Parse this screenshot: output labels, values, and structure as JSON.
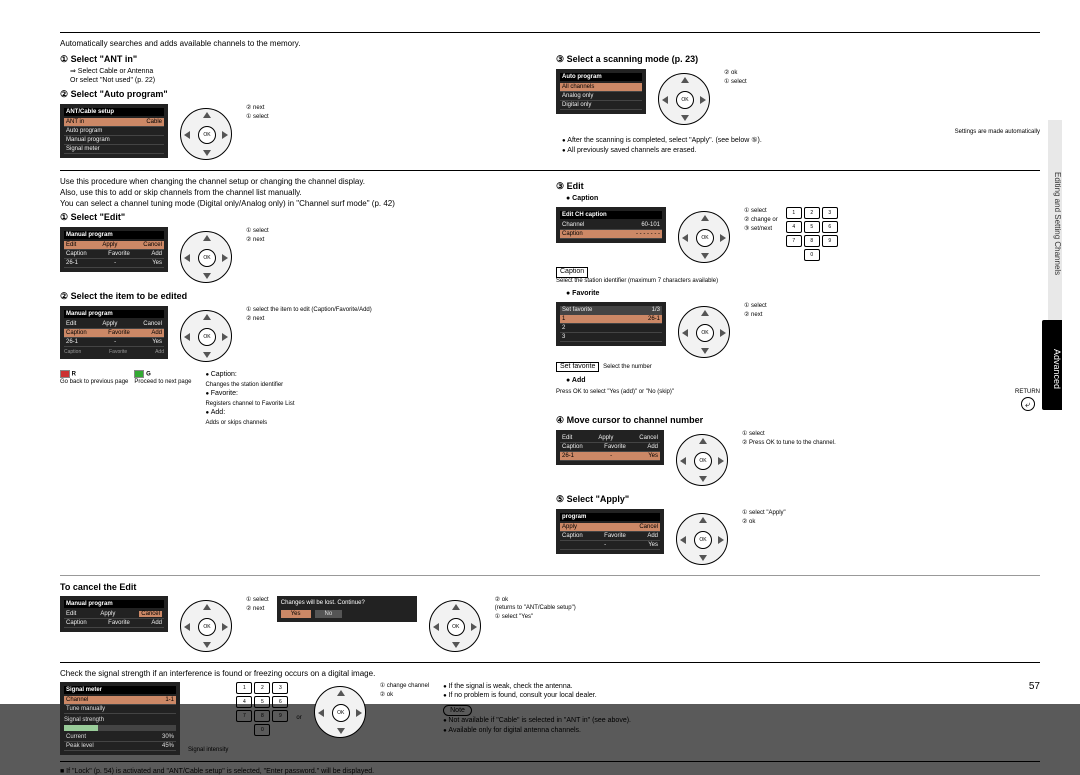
{
  "page_number": "57",
  "sidebar_grey": "Editing and Setting Channels",
  "sidebar_black": "Advanced",
  "section1": {
    "intro": "Automatically searches and adds available channels to the memory.",
    "step1_head": "① Select \"ANT in\"",
    "step1_sub1": "⇒ Select Cable or Antenna",
    "step1_sub2": "Or select \"Not used\" (p. 22)",
    "step2_head": "② Select \"Auto program\"",
    "menu1_title": "ANT/Cable setup",
    "menu1_r1a": "ANT in",
    "menu1_r1b": "Cable",
    "menu1_r2a": "Auto program",
    "menu1_r3a": "Manual program",
    "menu1_r4a": "Signal meter",
    "anno_next": "② next",
    "anno_select": "① select",
    "step3_head": "③ Select a scanning mode (p. 23)",
    "menu2_title": "Auto program",
    "menu2_r1": "All channels",
    "menu2_r2": "Analog only",
    "menu2_r3": "Digital only",
    "anno_ok": "② ok",
    "anno_sel1": "① select",
    "auto_note": "Settings are made automatically",
    "bullet1": "After the scanning is completed, select \"Apply\". (see below ⑤).",
    "bullet2": "All previously saved channels are erased."
  },
  "section2": {
    "intro1": "Use this procedure when changing the channel setup or changing the channel display.",
    "intro2": "Also, use this to add or skip channels from the channel list manually.",
    "intro3": "You can select a channel tuning mode (Digital only/Analog only) in \"Channel surf mode\" (p. 42)",
    "step1_head": "① Select \"Edit\"",
    "menu3_title": "Manual program",
    "menu3_r1a": "Edit",
    "menu3_r1b": "Apply",
    "menu3_r1c": "Cancel",
    "menu3_r2a": "Caption",
    "menu3_r2b": "Favorite",
    "menu3_r2c": "Add",
    "menu3_r3a": "26-1",
    "menu3_r3b": "-",
    "menu3_r3c": "Yes",
    "anno_s1_select": "① select",
    "anno_s1_next": "② next",
    "step2_head": "② Select the item to be edited",
    "anno_item1": "① select the item to edit (Caption/Favorite/Add)",
    "anno_item2": "② next",
    "label_caption": "Caption",
    "label_favorite": "Favorite",
    "label_add": "Add",
    "remote_r": "R",
    "remote_g": "G",
    "remote_r_note": "Go back to previous page",
    "remote_g_note": "Proceed to next page",
    "bullet_caption": "Caption:",
    "bullet_caption_d": "Changes the station identifier",
    "bullet_favorite": "Favorite:",
    "bullet_favorite_d": "Registers channel to Favorite List",
    "bullet_add": "Add:",
    "bullet_add_d": "Adds or skips channels",
    "step3_head": "③ Edit",
    "step3_sub": "● Caption",
    "menu4_title": "Edit CH caption",
    "menu4_r1a": "Channel",
    "menu4_r1b": "60-101",
    "menu4_r2a": "Caption",
    "menu4_r2b": "- - - - - - -",
    "anno_c1": "① select",
    "anno_c2": "② change",
    "anno_c3": "③ set/next",
    "or": "or",
    "caption_box": "Caption",
    "caption_note": "Select the station identifier (maximum 7 characters available)",
    "step3_fav": "● Favorite",
    "menu5_title": "Set favorite",
    "menu5_pager": "1/3",
    "menu5_r1a": "1",
    "menu5_r1b": "26-1",
    "anno_f1": "① select",
    "anno_f2": "② next",
    "setfav_box": "Set favorite",
    "setfav_note": "Select the number",
    "step3_add": "● Add",
    "add_note": "Press OK to select \"Yes (add)\" or \"No (skip)\"",
    "return_label": "RETURN",
    "step4_head": "④ Move cursor to channel number",
    "anno_m1": "① select",
    "anno_m2": "② Press OK to tune to the channel.",
    "step5_head": "⑤ Select \"Apply\"",
    "menu6_title": "program",
    "menu6_r1a": "Apply",
    "menu6_r1b": "Cancel",
    "menu6_r2a": "Caption",
    "menu6_r2b": "Favorite",
    "menu6_r2c": "Add",
    "menu6_r3a": "-",
    "menu6_r3b": "Yes",
    "anno_ap1": "① select \"Apply\"",
    "anno_ap2": "② ok",
    "cancel_head": "To cancel the Edit",
    "dialog_msg": "Changes will be lost. Continue?",
    "dialog_yes": "Yes",
    "dialog_no": "No",
    "anno_cx1": "① select",
    "anno_cx2": "② next",
    "anno_cx_ok": "② ok",
    "anno_cx_ret": "(returns to \"ANT/Cable setup\")",
    "anno_cx_sel": "① select \"Yes\""
  },
  "section3": {
    "intro": "Check the signal strength if an interference is found or freezing occurs on a digital image.",
    "sig_title": "Signal meter",
    "sig_channel": "Channel",
    "sig_ch_val": "1-1",
    "sig_tune": "Tune manually",
    "sig_strength": "Signal strength",
    "sig_current": "Current",
    "sig_current_v": "30%",
    "sig_peak": "Peak level",
    "sig_peak_v": "45%",
    "sig_intensity": "Signal intensity",
    "or": "or",
    "anno_ch": "① change channel",
    "anno_ok": "② ok",
    "bullet1": "If the signal is weak, check the antenna.",
    "bullet2": "If no problem is found, consult your local dealer.",
    "note_label": "Note",
    "note1": "Not available if \"Cable\" is selected in \"ANT in\" (see above).",
    "note2": "Available only for digital antenna channels."
  },
  "footnote": "■ If \"Lock\" (p. 54) is activated and \"ANT/Cable setup\" is selected, \"Enter password.\" will be displayed."
}
